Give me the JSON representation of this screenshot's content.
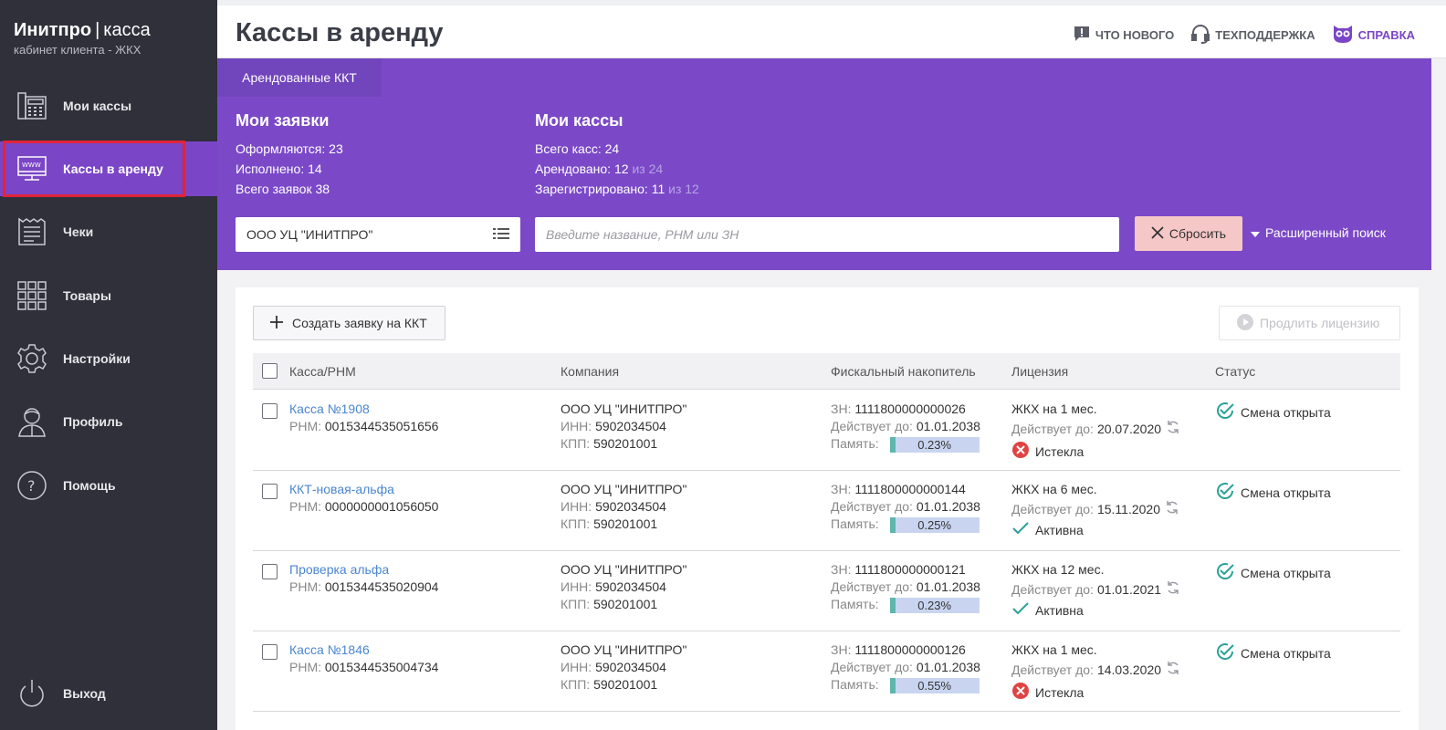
{
  "brand": {
    "name": "Инитпро",
    "product": "касса",
    "subtitle": "кабинет клиента - ЖКХ"
  },
  "sidebar": {
    "items": [
      {
        "label": "Мои кассы",
        "icon": "cash-register-icon"
      },
      {
        "label": "Кассы в аренду",
        "icon": "www-monitor-icon"
      },
      {
        "label": "Чеки",
        "icon": "receipt-icon"
      },
      {
        "label": "Товары",
        "icon": "grid-icon"
      },
      {
        "label": "Настройки",
        "icon": "gear-icon"
      },
      {
        "label": "Профиль",
        "icon": "user-icon"
      },
      {
        "label": "Помощь",
        "icon": "help-icon"
      }
    ],
    "logout": {
      "label": "Выход",
      "icon": "power-icon"
    }
  },
  "header": {
    "title": "Кассы в аренду",
    "links": {
      "news": "ЧТО НОВОГО",
      "support": "ТЕХПОДДЕРЖКА",
      "help": "СПРАВКА"
    }
  },
  "tab": {
    "label": "Арендованные ККТ"
  },
  "requests": {
    "title": "Мои заявки",
    "processing": "Оформляются: 23",
    "done": "Исполнено: 14",
    "total": "Всего заявок 38"
  },
  "registers": {
    "title": "Мои кассы",
    "total": "Всего касс: 24",
    "rented": "Арендовано: 12",
    "rented_of": "из 24",
    "registered": "Зарегистрировано: 11",
    "registered_of": "из 12"
  },
  "filters": {
    "company": "ООО УЦ \"ИНИТПРО\"",
    "search_placeholder": "Введите название, РНМ или ЗН",
    "reset_label": "Сбросить",
    "advanced_label": "Расширенный поиск"
  },
  "actions": {
    "create": "Создать заявку на ККТ",
    "renew": "Продлить лицензию"
  },
  "table": {
    "columns": [
      "Касса/РНМ",
      "Компания",
      "Фискальный накопитель",
      "Лицензия",
      "Статус"
    ],
    "labels": {
      "rnm": "РНМ:",
      "inn": "ИНН:",
      "kpp": "КПП:",
      "zn": "ЗН:",
      "valid_until": "Действует до:",
      "memory": "Память:"
    },
    "rows": [
      {
        "name": "Касса №1908",
        "rnm": "0015344535051656",
        "company": "ООО УЦ \"ИНИТПРО\"",
        "inn": "5902034504",
        "kpp": "590201001",
        "zn": "1111800000000026",
        "fn_valid": "01.01.2038",
        "memory": "0.23%",
        "memory_value": 0.23,
        "license": "ЖКХ на 1 мес.",
        "license_valid": "20.07.2020",
        "license_state": "Истекла",
        "license_state_type": "expired",
        "status": "Смена открыта"
      },
      {
        "name": "ККТ-новая-альфа",
        "rnm": "0000000001056050",
        "company": "ООО УЦ \"ИНИТПРО\"",
        "inn": "5902034504",
        "kpp": "590201001",
        "zn": "1111800000000144",
        "fn_valid": "01.01.2038",
        "memory": "0.25%",
        "memory_value": 0.25,
        "license": "ЖКХ на 6 мес.",
        "license_valid": "15.11.2020",
        "license_state": "Активна",
        "license_state_type": "active",
        "status": "Смена открыта"
      },
      {
        "name": "Проверка альфа",
        "rnm": "0015344535020904",
        "company": "ООО УЦ \"ИНИТПРО\"",
        "inn": "5902034504",
        "kpp": "590201001",
        "zn": "1111800000000121",
        "fn_valid": "01.01.2038",
        "memory": "0.23%",
        "memory_value": 0.23,
        "license": "ЖКХ на 12 мес.",
        "license_valid": "01.01.2021",
        "license_state": "Активна",
        "license_state_type": "active",
        "status": "Смена открыта"
      },
      {
        "name": "Касса №1846",
        "rnm": "0015344535004734",
        "company": "ООО УЦ \"ИНИТПРО\"",
        "inn": "5902034504",
        "kpp": "590201001",
        "zn": "1111800000000126",
        "fn_valid": "01.01.2038",
        "memory": "0.55%",
        "memory_value": 0.55,
        "license": "ЖКХ на 1 мес.",
        "license_valid": "14.03.2020",
        "license_state": "Истекла",
        "license_state_type": "expired",
        "status": "Смена открыта"
      }
    ]
  },
  "colors": {
    "accent": "#7b49c7",
    "sidebar": "#2f3039",
    "link": "#4a86d1",
    "ok": "#2aa198",
    "error": "#e04343"
  }
}
